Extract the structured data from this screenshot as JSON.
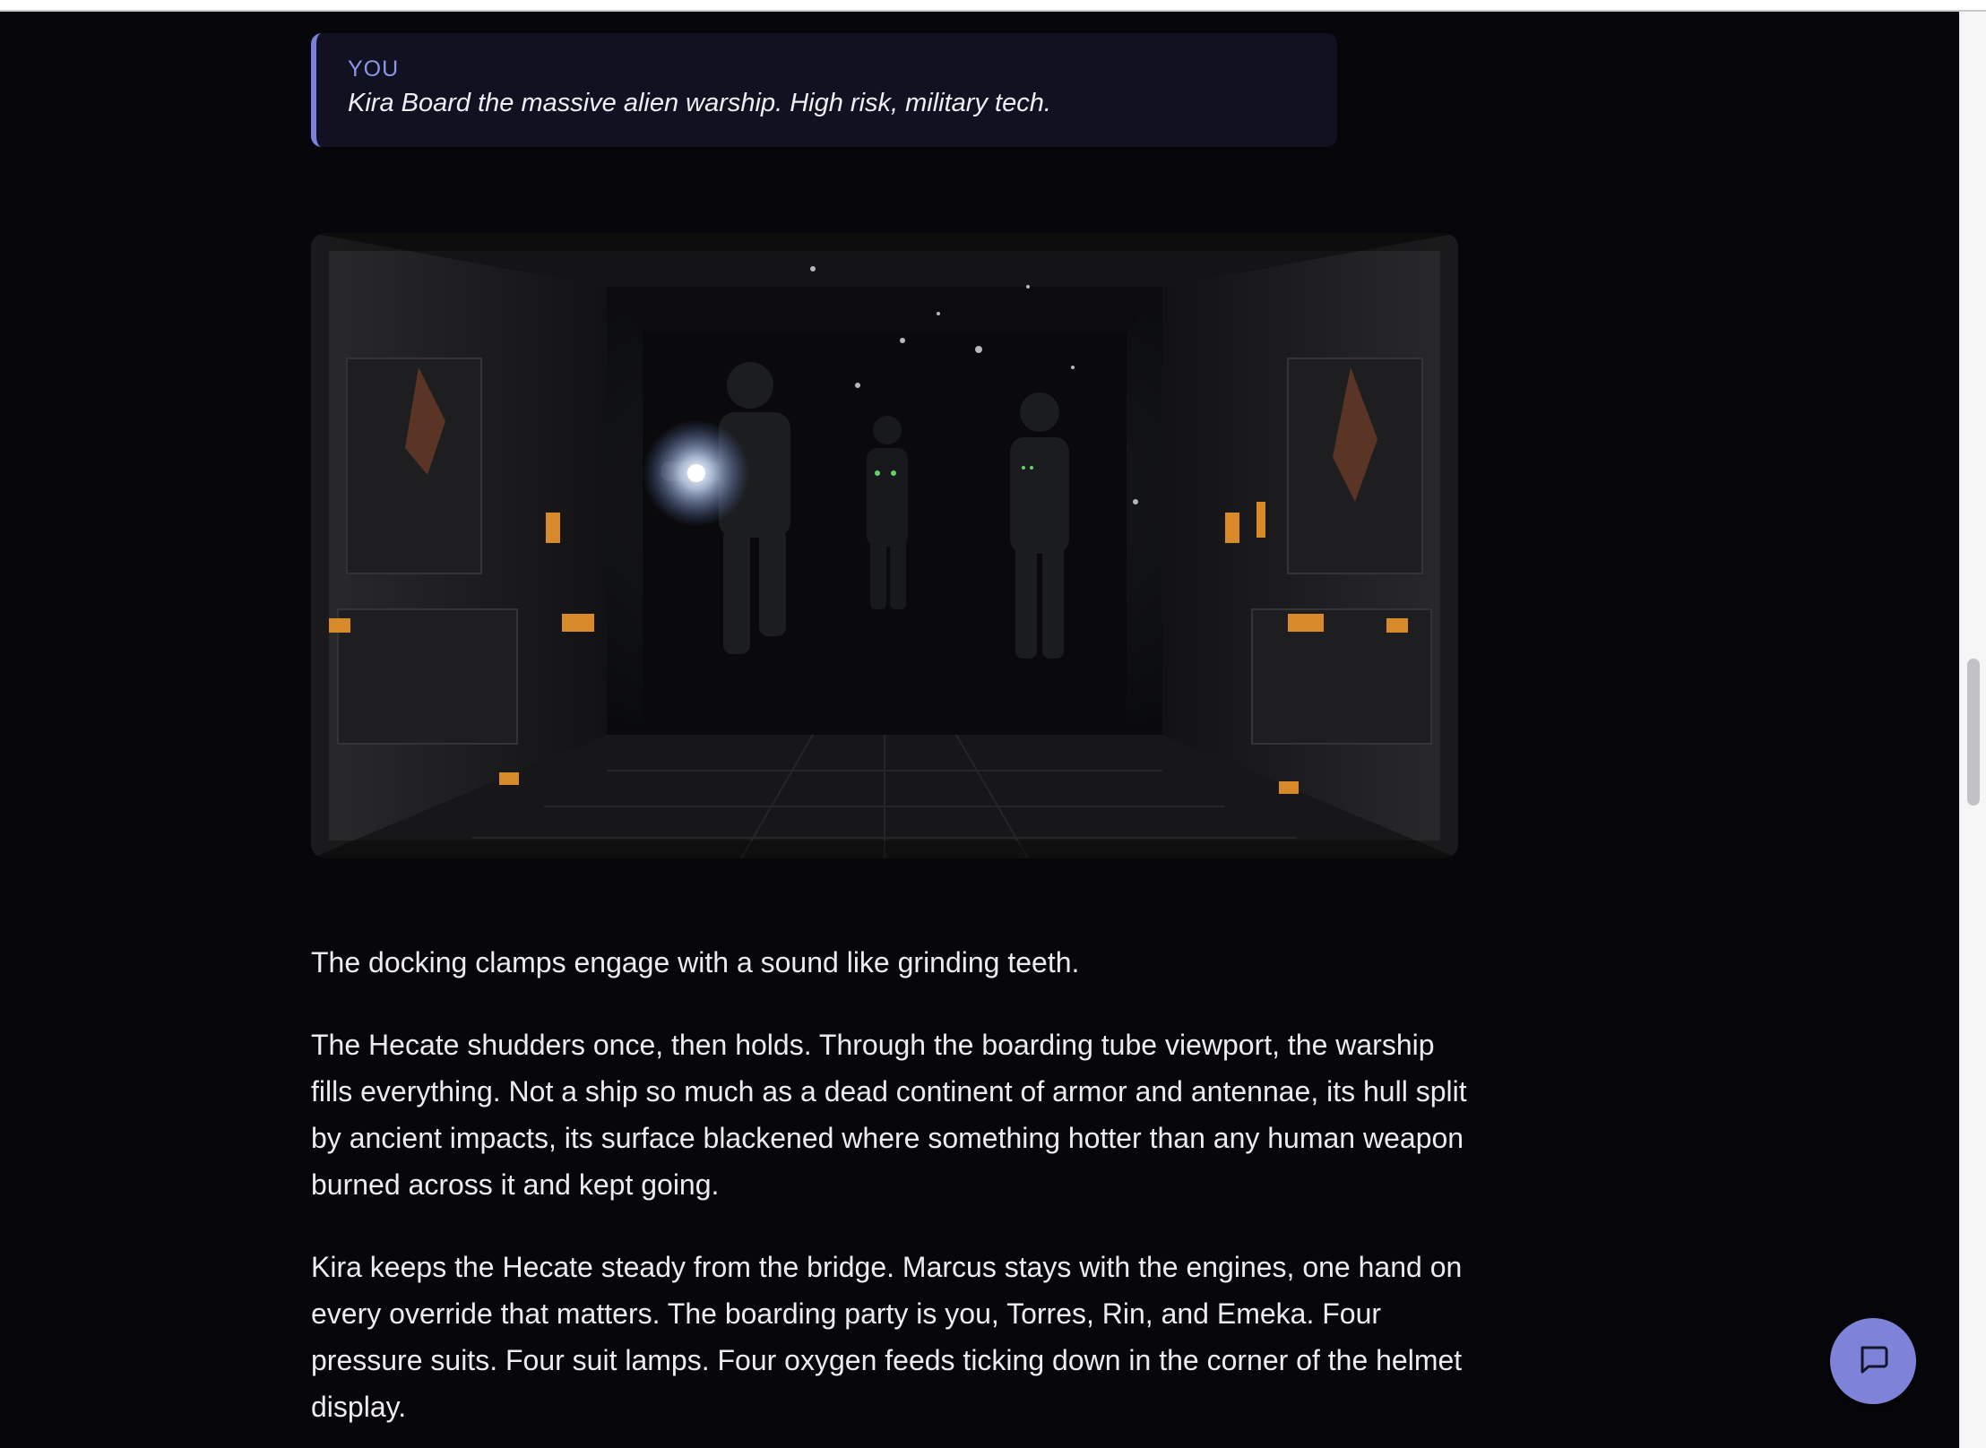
{
  "player_turn": {
    "speaker": "YOU",
    "action": "Kira Board the massive alien warship. High risk, military tech."
  },
  "scene_image": {
    "icon": "scene-illustration"
  },
  "narration": {
    "paragraphs": [
      "The docking clamps engage with a sound like grinding teeth.",
      "The Hecate shudders once, then holds. Through the boarding tube viewport, the warship fills everything. Not a ship so much as a dead continent of armor and antennae, its hull split by ancient impacts, its surface blackened where something hotter than any human weapon burned across it and kept going.",
      "Kira keeps the Hecate steady from the bridge. Marcus stays with the engines, one hand on every override that matters. The boarding party is you, Torres, Rin, and Emeka. Four pressure suits. Four suit lamps. Four oxygen feeds ticking down in the corner of the helmet display."
    ]
  },
  "chat_button": {
    "icon": "chat-bubble-icon",
    "color": "#7e82d8"
  },
  "colors": {
    "background": "#07070b",
    "accent": "#7a80dc",
    "text": "#ececf0"
  }
}
